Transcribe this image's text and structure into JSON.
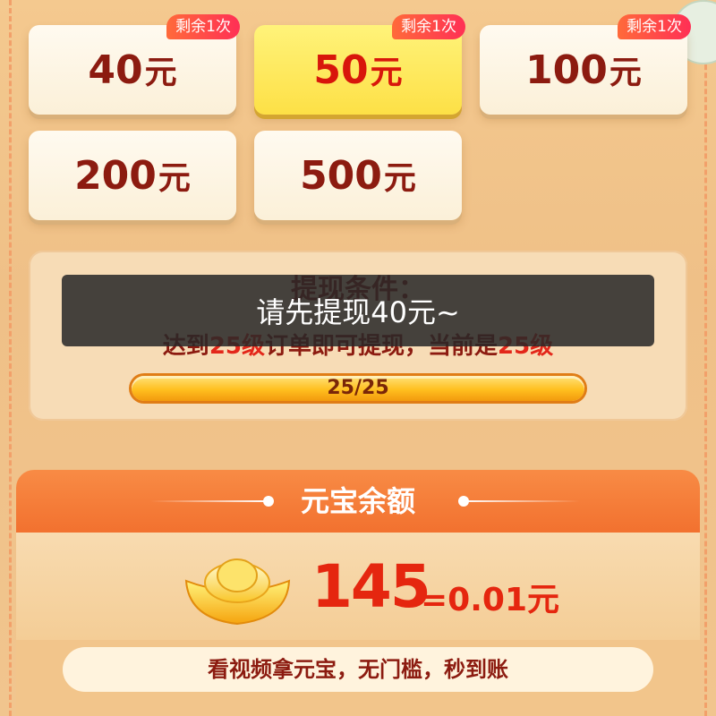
{
  "options": [
    {
      "amount": "40",
      "unit": "元",
      "badge": "剩余1次",
      "selected": false
    },
    {
      "amount": "50",
      "unit": "元",
      "badge": "剩余1次",
      "selected": true
    },
    {
      "amount": "100",
      "unit": "元",
      "badge": "剩余1次",
      "selected": false
    },
    {
      "amount": "200",
      "unit": "元",
      "badge": "",
      "selected": false
    },
    {
      "amount": "500",
      "unit": "元",
      "badge": "",
      "selected": false
    }
  ],
  "condition": {
    "title": "提现条件：",
    "text_prefix": "达到",
    "required_level": "25级",
    "text_middle": "订单即可提现，当前是",
    "current_level": "25级",
    "progress_label": "25/25",
    "progress_fraction": 1.0
  },
  "toast": "请先提现40元~",
  "balance": {
    "title": "元宝余额",
    "amount": "145",
    "equivalent": "=0.01元",
    "task": "看视频拿元宝，无门槛，秒到账"
  },
  "colors": {
    "accent_red": "#e5260f",
    "dark_red": "#8c1b10",
    "selected_yellow": "#fde046",
    "badge_pink": "#ff2f55"
  }
}
